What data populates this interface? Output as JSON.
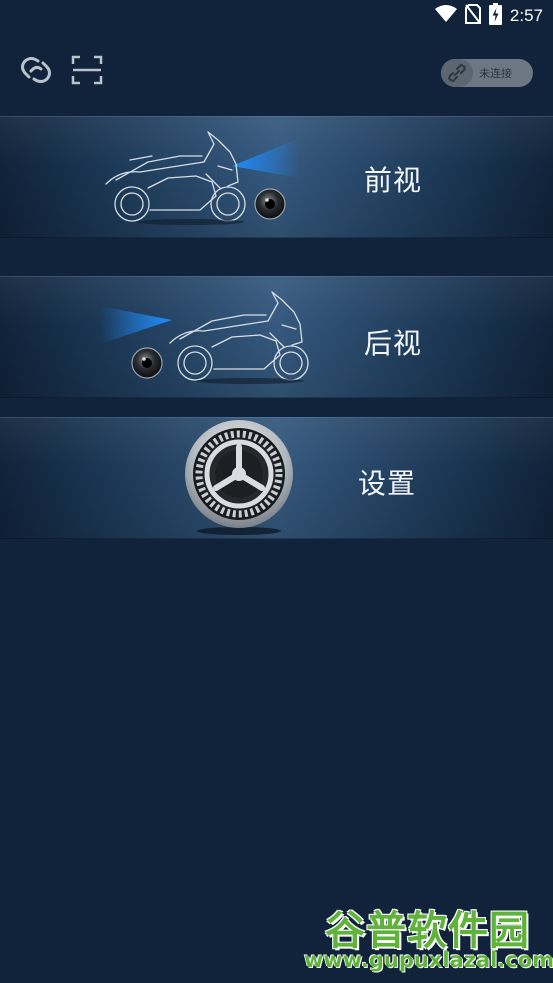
{
  "status_bar": {
    "time": "2:57",
    "icons": [
      "wifi-icon",
      "no-sim-icon",
      "battery-charging-icon"
    ]
  },
  "top_bar": {
    "left_icons": [
      "link-rings-icon",
      "scan-icon"
    ],
    "connection_status": "未连接",
    "connection_icon": "chain-link-icon"
  },
  "menu": {
    "items": [
      {
        "label": "前视",
        "icon": "front-camera-motorcycle-icon"
      },
      {
        "label": "后视",
        "icon": "rear-camera-motorcycle-icon"
      },
      {
        "label": "设置",
        "icon": "settings-gear-icon"
      }
    ]
  },
  "watermark": {
    "title": "谷普软件园",
    "url": "www.gupuxlazal.com"
  },
  "colors": {
    "background": "#10233a",
    "card_center": "#35597e",
    "beam_blue": "#1f8fff",
    "watermark_green": "#5fb33a"
  }
}
